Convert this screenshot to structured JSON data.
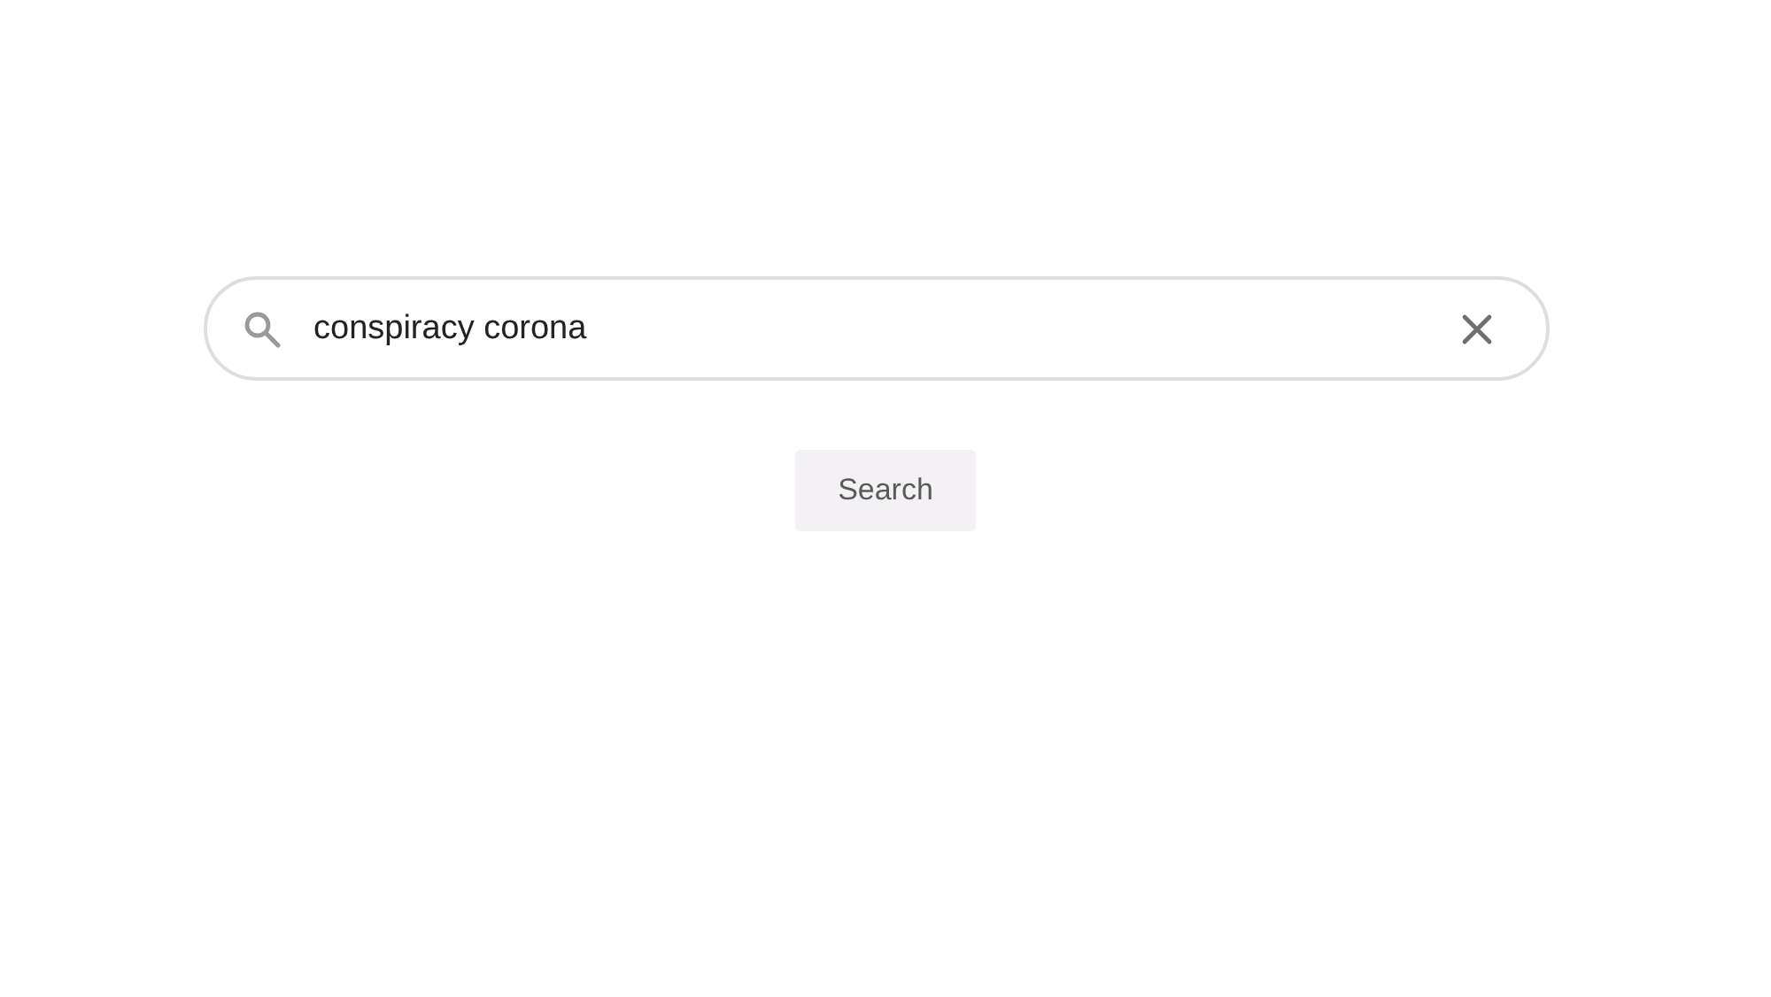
{
  "search": {
    "value": "conspiracy corona"
  },
  "buttons": [
    {
      "label": "Search"
    }
  ]
}
